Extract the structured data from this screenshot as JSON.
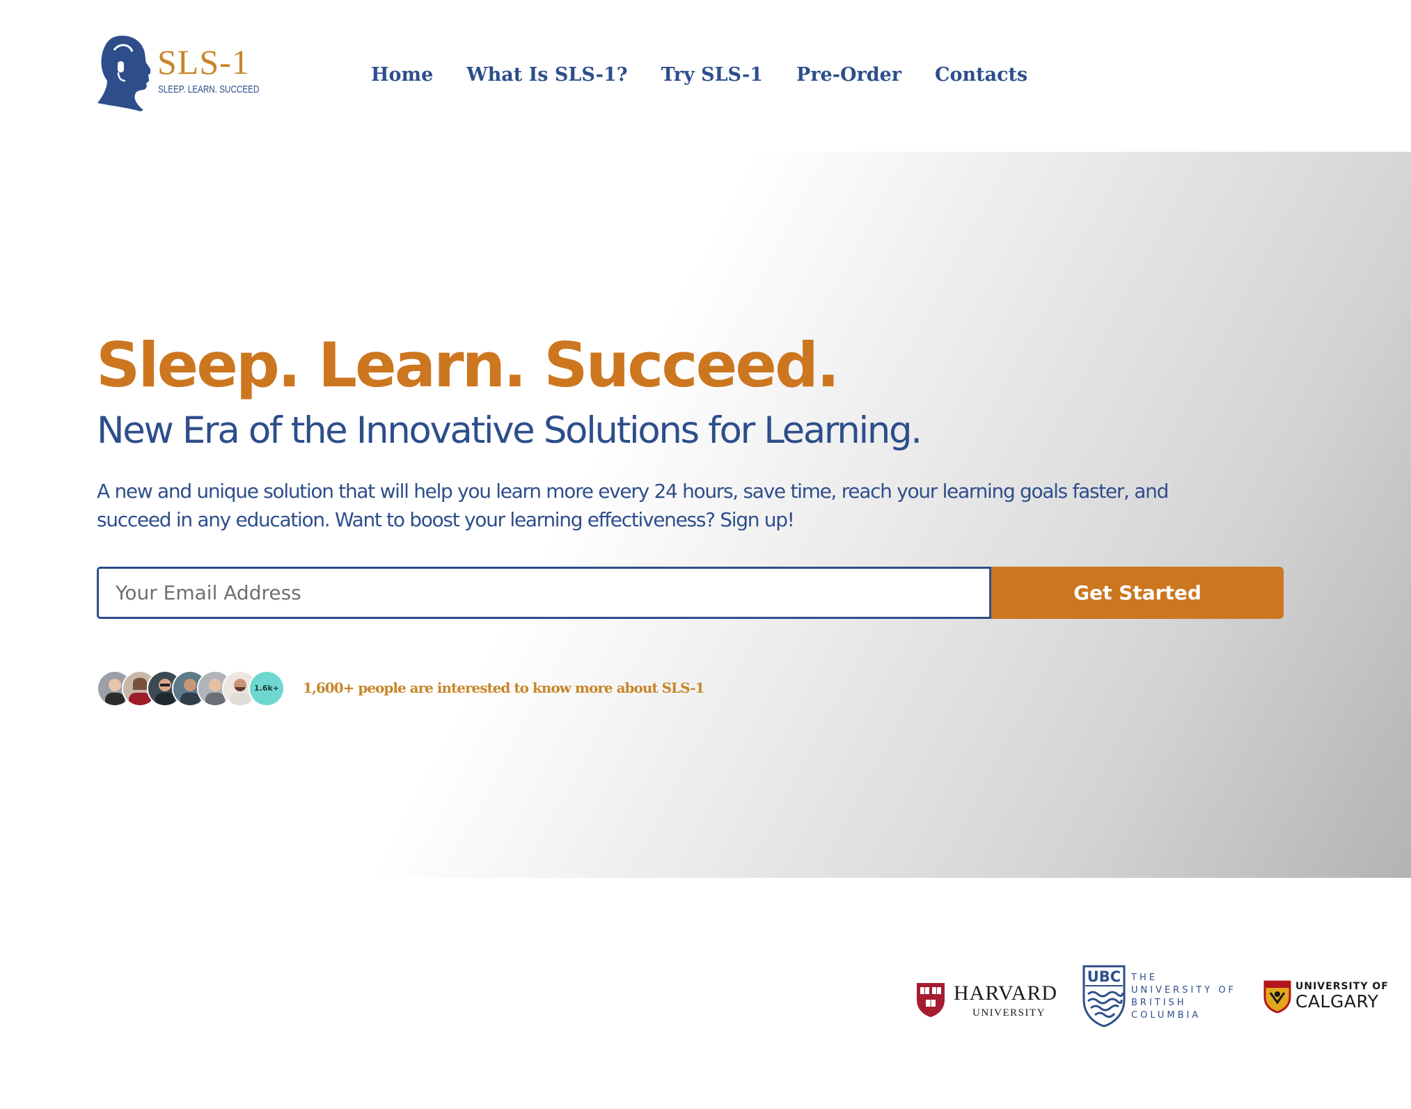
{
  "brand": {
    "name": "SLS-1",
    "tagline": "SLEEP. LEARN. SUCCEED",
    "colors": {
      "primary_blue": "#2d4e8b",
      "accent_orange": "#cd7620",
      "gold": "#c7862a"
    }
  },
  "nav": {
    "items": [
      {
        "label": "Home"
      },
      {
        "label": "What Is SLS-1?"
      },
      {
        "label": "Try SLS-1"
      },
      {
        "label": "Pre-Order"
      },
      {
        "label": "Contacts"
      }
    ]
  },
  "hero": {
    "title": "Sleep. Learn. Succeed.",
    "subtitle": "New Era of the Innovative Solutions for Learning.",
    "description": "A new and unique solution that will help you learn more every 24 hours, save time, reach your learning goals faster, and succeed in any education. Want to boost your learning effectiveness? Sign up!",
    "signup": {
      "email_placeholder": "Your Email Address",
      "email_value": "",
      "button_label": "Get Started"
    },
    "social_proof": {
      "count_badge": "1.6k+",
      "text": "1,600+ people are interested to know more about SLS-1"
    }
  },
  "partners": {
    "harvard": {
      "name": "HARVARD",
      "sub": "UNIVERSITY",
      "icon": "harvard-shield-icon"
    },
    "ubc": {
      "mark": "UBC",
      "lines": [
        "THE",
        "UNIVERSITY OF",
        "BRITISH",
        "COLUMBIA"
      ],
      "icon": "ubc-crest-icon"
    },
    "calgary": {
      "line1": "UNIVERSITY OF",
      "line2": "CALGARY",
      "icon": "calgary-crest-icon"
    }
  }
}
